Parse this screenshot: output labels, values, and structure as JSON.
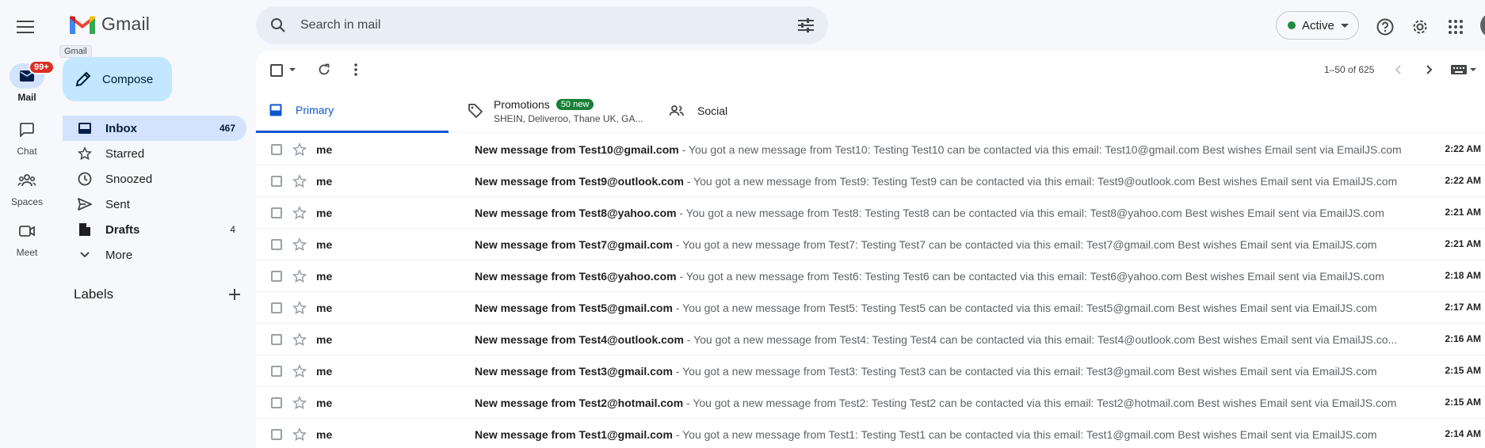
{
  "app": {
    "name": "Gmail",
    "tooltip": "Gmail"
  },
  "search": {
    "placeholder": "Search in mail"
  },
  "status": {
    "label": "Active",
    "color": "#1e8e3e"
  },
  "rail": {
    "mail_label": "Mail",
    "mail_badge": "99+",
    "chat_label": "Chat",
    "spaces_label": "Spaces",
    "meet_label": "Meet"
  },
  "compose": {
    "label": "Compose"
  },
  "nav": {
    "inbox": {
      "label": "Inbox",
      "count": "467"
    },
    "starred": {
      "label": "Starred"
    },
    "snoozed": {
      "label": "Snoozed"
    },
    "sent": {
      "label": "Sent"
    },
    "drafts": {
      "label": "Drafts",
      "count": "4"
    },
    "more": {
      "label": "More"
    }
  },
  "labels": {
    "title": "Labels"
  },
  "toolbar": {
    "pager": "1–50 of 625"
  },
  "tabs": {
    "primary": "Primary",
    "promotions": "Promotions",
    "promotions_badge": "50 new",
    "promotions_sub": "SHEIN, Deliveroo, Thane UK, GA...",
    "social": "Social"
  },
  "emails": [
    {
      "sender": "me",
      "subject": "New message from Test10@gmail.com",
      "snippet": " - You got a new message from Test10: Testing Test10 can be contacted via this email: Test10@gmail.com Best wishes Email sent via EmailJS.com",
      "time": "2:22 AM"
    },
    {
      "sender": "me",
      "subject": "New message from Test9@outlook.com",
      "snippet": " - You got a new message from Test9: Testing Test9 can be contacted via this email: Test9@outlook.com Best wishes Email sent via EmailJS.com",
      "time": "2:22 AM"
    },
    {
      "sender": "me",
      "subject": "New message from Test8@yahoo.com",
      "snippet": " - You got a new message from Test8: Testing Test8 can be contacted via this email: Test8@yahoo.com Best wishes Email sent via EmailJS.com",
      "time": "2:21 AM"
    },
    {
      "sender": "me",
      "subject": "New message from Test7@gmail.com",
      "snippet": " - You got a new message from Test7: Testing Test7 can be contacted via this email: Test7@gmail.com Best wishes Email sent via EmailJS.com",
      "time": "2:21 AM"
    },
    {
      "sender": "me",
      "subject": "New message from Test6@yahoo.com",
      "snippet": " - You got a new message from Test6: Testing Test6 can be contacted via this email: Test6@yahoo.com Best wishes Email sent via EmailJS.com",
      "time": "2:18 AM"
    },
    {
      "sender": "me",
      "subject": "New message from Test5@gmail.com",
      "snippet": " - You got a new message from Test5: Testing Test5 can be contacted via this email: Test5@gmail.com Best wishes Email sent via EmailJS.com",
      "time": "2:17 AM"
    },
    {
      "sender": "me",
      "subject": "New message from Test4@outlook.com",
      "snippet": " - You got a new message from Test4: Testing Test4 can be contacted via this email: Test4@outlook.com Best wishes Email sent via EmailJS.co...",
      "time": "2:16 AM"
    },
    {
      "sender": "me",
      "subject": "New message from Test3@gmail.com",
      "snippet": " - You got a new message from Test3: Testing Test3 can be contacted via this email: Test3@gmail.com Best wishes Email sent via EmailJS.com",
      "time": "2:15 AM"
    },
    {
      "sender": "me",
      "subject": "New message from Test2@hotmail.com",
      "snippet": " - You got a new message from Test2: Testing Test2 can be contacted via this email: Test2@hotmail.com Best wishes Email sent via EmailJS.com",
      "time": "2:15 AM"
    },
    {
      "sender": "me",
      "subject": "New message from Test1@gmail.com",
      "snippet": " - You got a new message from Test1: Testing Test1 can be contacted via this email: Test1@gmail.com Best wishes Email sent via EmailJS.com",
      "time": "2:14 AM"
    }
  ],
  "colors": {
    "accent": "#0b57d0",
    "compose_bg": "#c2e7ff",
    "selected_bg": "#d3e3fd",
    "badge_red": "#d93025",
    "promo_green": "#188038"
  }
}
